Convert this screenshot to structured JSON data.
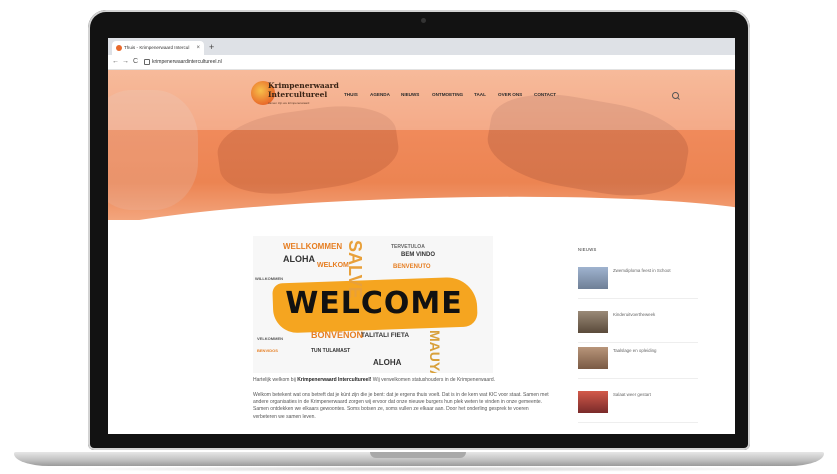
{
  "browser": {
    "tab_title": "Thuis - Krimpenerwaard Intercul",
    "tab_close": "×",
    "new_tab": "+",
    "url": "krimpenerwaardintercultureel.nl",
    "back": "←",
    "forward": "→",
    "reload": "C"
  },
  "site": {
    "logo_line1": "Krimpenerwaard",
    "logo_line2": "Intercultureel",
    "logo_tagline": "samen zijn we krimpenerwaard",
    "menu": [
      "THUIS",
      "AGENDA",
      "NIEUWS",
      "ONTMOETING",
      "TAAL",
      "OVER ONS",
      "CONTACT"
    ]
  },
  "welcome_image": {
    "main_word": "WELCOME",
    "words": [
      "WELLKOMMEN",
      "ALOHA",
      "WELKOM",
      "BONVENON",
      "TALITALI FIETA",
      "BENVENUTO",
      "TERVETULOA",
      "BIENVENIDO",
      "SALVE",
      "MAUYA",
      "HUAN YING",
      "BEM VINDO",
      "TUN TULAMAST",
      "AHLAN WA SAHLAN",
      "VELKOMMEN",
      "KALOS ORISATE",
      "BENVIDOS",
      "VALKOMMEN",
      "WILLKOMMEN",
      "SWAGATAM"
    ]
  },
  "content": {
    "intro_prefix": "Hartelijk welkom bij ",
    "intro_bold": "Krimpenerwaard Intercultureel!",
    "intro_suffix": " Wij verwelkomen statushouders in de Krimpenerwaard.",
    "paragraph": "Welkom betekent wat ons betreft dat je kúnt zijn die je bent: dat je ergens thuis voelt. Dat is in de kern wat KIC voor staat. Samen met andere organisaties in de Krimpenerwaard zorgen wij ervoor dat onze nieuwe burgers hun plek weten te vinden in onze gemeente. Samen ontdekken we elkaars gewoontes. Soms botsen ze, soms vullen ze elkaar aan. Door het onderling gesprek te voeren verbeteren we samen leven."
  },
  "sidebar": {
    "title": "NIEUWS",
    "items": [
      {
        "title": "Zwemdiploma feest in Schoot",
        "thumb_color": "#7a8aa6"
      },
      {
        "title": "Kinderuitvoertheweek",
        "thumb_color": "#6b5a4a"
      },
      {
        "title": "Taalslage en opleiding",
        "thumb_color": "#8a6b52"
      },
      {
        "title": "Salaat weer gestart",
        "thumb_color": "#c0392b"
      }
    ]
  },
  "colors": {
    "hero_orange": "#ec8452",
    "accent": "#e8692b"
  }
}
